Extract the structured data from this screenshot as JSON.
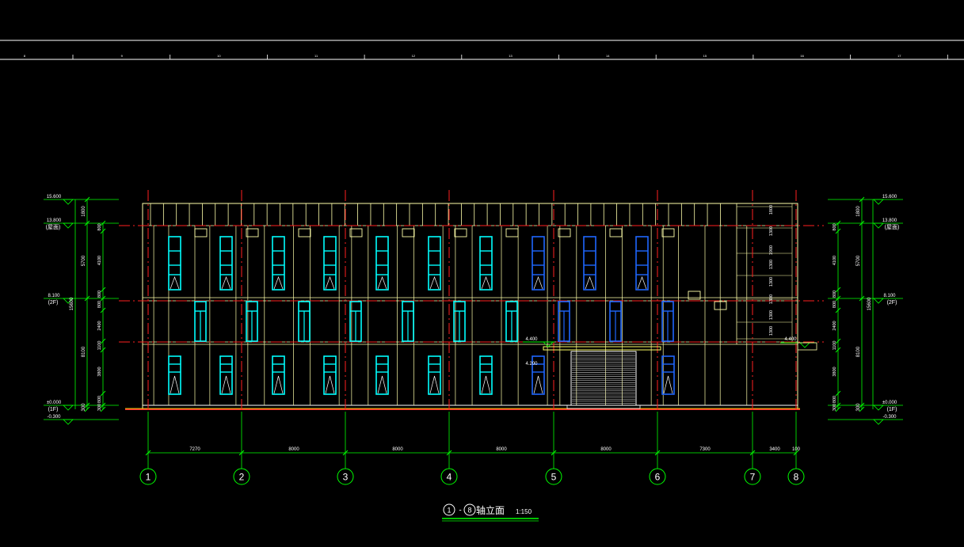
{
  "ruler": {
    "marks": [
      "8",
      "9",
      "10",
      "11",
      "12",
      "13",
      "14",
      "15",
      "16",
      "17"
    ]
  },
  "levels_left": [
    {
      "value": "15.600",
      "tag": ""
    },
    {
      "value": "13.800",
      "tag": "(屋面)"
    },
    {
      "value": "8.100",
      "tag": "(2F)"
    },
    {
      "value": "±0.000",
      "tag": "(1F)"
    },
    {
      "value": "-0.300",
      "tag": ""
    }
  ],
  "levels_right": [
    {
      "value": "15.600",
      "tag": ""
    },
    {
      "value": "13.800",
      "tag": "(屋面)"
    },
    {
      "value": "8.100",
      "tag": "(2F)"
    },
    {
      "value": "±0.000",
      "tag": "(1F)"
    },
    {
      "value": "-0.300",
      "tag": ""
    }
  ],
  "left_dims": {
    "outer": [
      "1800",
      "5700",
      "8100",
      "300"
    ],
    "inner": [
      "800",
      "4100",
      "800",
      "800",
      "2400",
      "1100",
      "3800",
      "800",
      "300"
    ],
    "total": "15600"
  },
  "right_dims": {
    "outer": [
      "1800",
      "5700",
      "8100",
      "300"
    ],
    "inner": [
      "800",
      "4100",
      "800",
      "800",
      "2400",
      "1100",
      "3800",
      "800",
      "300"
    ],
    "total": "15600"
  },
  "stair_dims": [
    "1800",
    "1300",
    "1900",
    "1300",
    "1300",
    "1300",
    "1300",
    "1300"
  ],
  "canopy_levels": [
    "4.400",
    "4.200"
  ],
  "annex_level": "4.400",
  "axes": [
    "1",
    "2",
    "3",
    "4",
    "5",
    "6",
    "7",
    "8"
  ],
  "spans": [
    "7270",
    "8000",
    "8000",
    "8000",
    "8000",
    "7300",
    "3400",
    "100"
  ],
  "title": {
    "from": "1",
    "to": "8",
    "dash": "-",
    "text": "轴立面",
    "scale": "1:150"
  },
  "colors": {
    "background": "#000000",
    "outline": "#ffffaa",
    "axis": "#ff2020",
    "dimension": "#00ff00",
    "window_cyan": "#00ffff",
    "window_blue": "#1e66ff",
    "frame_white": "#ffffff"
  }
}
